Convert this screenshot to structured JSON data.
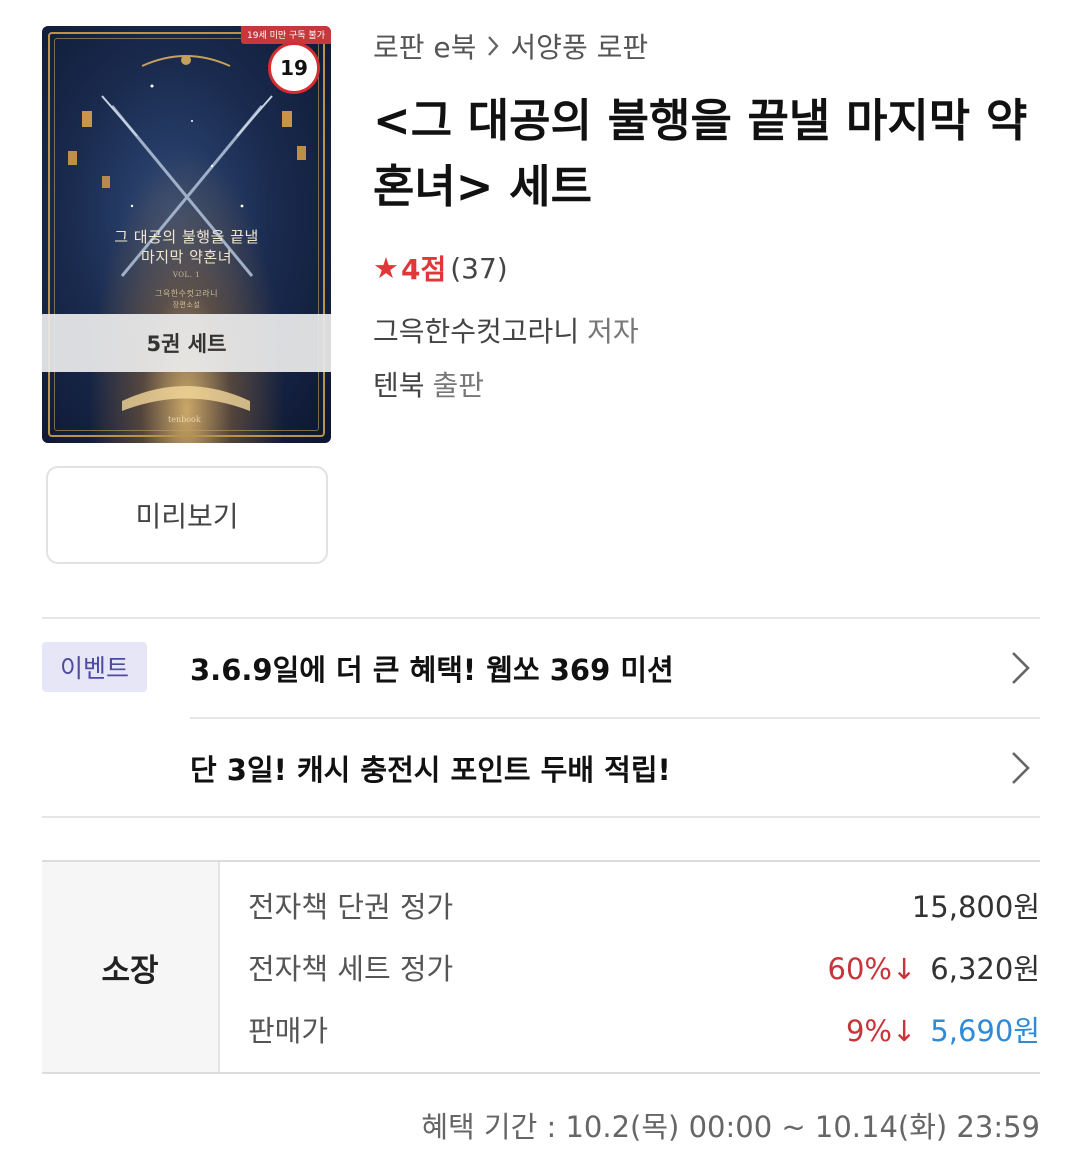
{
  "cover": {
    "age_warning": "19세 미만 구독 불가",
    "age_badge": "19",
    "title_line1": "그 대공의 불행을 끝낼",
    "title_line2": "마지막 약혼녀",
    "volume": "VOL. 1",
    "author": "그윽한수컷고라니",
    "genre": "장편소설",
    "set_label": "5권 세트",
    "publisher_logo": "tenbook"
  },
  "preview_button": "미리보기",
  "breadcrumb": {
    "category": "로판 e북",
    "subcategory": "서양풍 로판",
    "separator_icon": "chevron-right-icon"
  },
  "book": {
    "title": "<그 대공의 불행을 끝낼 마지막 약혼녀> 세트",
    "rating_score": "4점",
    "rating_count": "(37)",
    "author": "그윽한수컷고라니",
    "author_role": "저자",
    "publisher": "텐북",
    "publisher_role": "출판"
  },
  "events": {
    "badge": "이벤트",
    "items": [
      {
        "text": "3.6.9일에 더 큰 혜택! 웹쏘 369 미션"
      },
      {
        "text": "단 3일! 캐시 충전시 포인트 두배 적립!"
      }
    ]
  },
  "price": {
    "header": "소장",
    "rows": [
      {
        "label": "전자책 단권 정가",
        "discount": "",
        "value": "15,800원"
      },
      {
        "label": "전자책 세트 정가",
        "discount": "60%↓",
        "value": "6,320원"
      },
      {
        "label": "판매가",
        "discount": "9%↓",
        "value": "5,690원"
      }
    ],
    "benefit_period": "혜택 기간 : 10.2(목) 00:00 ~ 10.14(화) 23:59"
  },
  "colors": {
    "accent_red": "#e0383a",
    "discount_red": "#c8343a",
    "price_blue": "#2f8bd6",
    "event_badge_bg": "#e7e6f6"
  }
}
